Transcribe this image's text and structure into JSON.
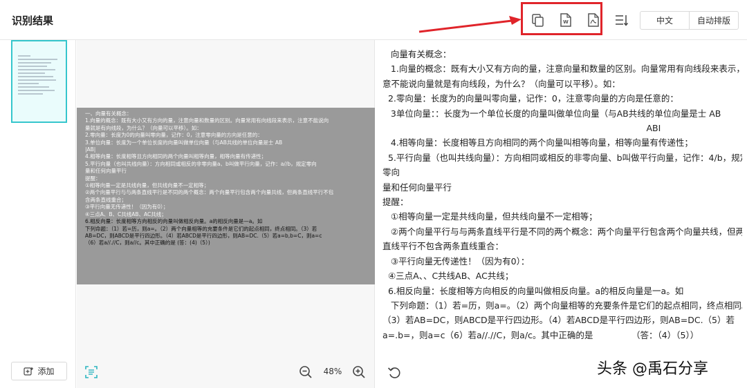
{
  "header": {
    "title": "识别结果",
    "export_icons": [
      "copy-icon",
      "word-icon",
      "pdf-icon"
    ],
    "sort_icon": "sort-icon",
    "language_label": "中文",
    "auto_layout_label": "自动排版",
    "highlight_color": "#e0242a"
  },
  "sidebar": {
    "add_label": "添加",
    "accent_color": "#35c6cc"
  },
  "preview": {
    "zoom_level": "48%",
    "scan_lines": [
      "一、向量有关概念：",
      "1.向量的概念：既有大小又有方向的量，注意向量和数量的区别。向量常用有向线段来表示，注意不能说向",
      "量就是有向线段，为什么？（向量可以平移）。如：",
      "2.零向量：长度为0的向量叫零向量，记作：0，注意零向量的方向是任意的：",
      "3.单位向量：长度为一个单位长度的向量叫做单位向量（与AB共线的单位向量是士 AB",
      "|AB|",
      "4.相等向量：长度相等且方向相同的两个向量叫相等向量，相等向量有传递性；",
      "5.平行向量（也叫共线向量）：方向相同或相反的非零向量a、b叫做平行向量，记作：a//b，规定零向",
      "量和任何向量平行",
      "提醒：",
      "①相等向量一定是共线向量，但共线向量不一定相等；",
      "②两个向量平行与与两条直线平行是不同的两个概念：两个向量平行包含两个向量共线，但两条直线平行不包",
      "含两条直线重合；",
      "③平行向量无传递性！（因为有0）；",
      "④三点A、B、C共线AB、AC共线；",
      "6.相反向量：长度相等方向相反的向量叫做相反向量。a的相反向量是—a。如",
      "下列命题：（1）若=历，则a=。（2）两个向量相等的充要条件是它们的起点相同，终点相同。（3）若",
      "AB=DC，则ABCD是平行四边形。（4）若ABCD是平行四边形，则AB=DC.（5）若a=b,b=C，则a=c",
      "（6）若a//.//C，则a//c。其中正确的是                (答：(4)（5）)"
    ]
  },
  "result": {
    "lines": [
      "   向量有关概念：",
      "   1.向量的概念：既有大小又有方向的量，注意向量和数量的区别。向量常用有向线段来表示，注",
      "意不能说向量就是有向线段，为什么？（向量可以平移）。如：",
      "  2.零向量：长度为的向量叫零向量，记作：0，注意零向量的方向是任意的：",
      "   3单位向量：：长度为一个单位长度的向量叫做单位向量（与AB共线的单位向量是士 AB",
      "                                                                                                ABI",
      "   4.相等向量：长度相等且方向相同的两个向量叫相等向量，相等向量有传递性；",
      "  5.平行向量（也叫共线向量）：方向相同或相反的非零向量、b叫做平行向量，记作：4/b，规定",
      "零向",
      "量和任何向量平行",
      "提醒：",
      "   ①相等向量一定是共线向量，但共线向量不一定相等；",
      "   ②两个向量平行与与两条直线平行是不同的两个概念：两个向量平行包含两个向量共线，但两条",
      "直线平行不包含两条直线重合：",
      "   ③平行向量无传递性！（因为有0）：",
      "  ④三点A、、C共线AB、AC共线；",
      "  6.相反向量：长度相等方向相反的向量叫做相反向量。a的相反向量是一a。如",
      "   下列命题：（1）若=历，则a=。（2）两个向量相等的充要条件是它们的起点相同，终点相同。",
      "（3）若AB=DC，则ABCD是平行四边形。（4）若ABCD是平行四边形，则AB=DC.（5）若",
      "a=.b=，则a=c（6）若a//.//C，则a/c。其中正确的是              （答：（4）（5））"
    ]
  },
  "watermark": "头条 @禹石分享"
}
